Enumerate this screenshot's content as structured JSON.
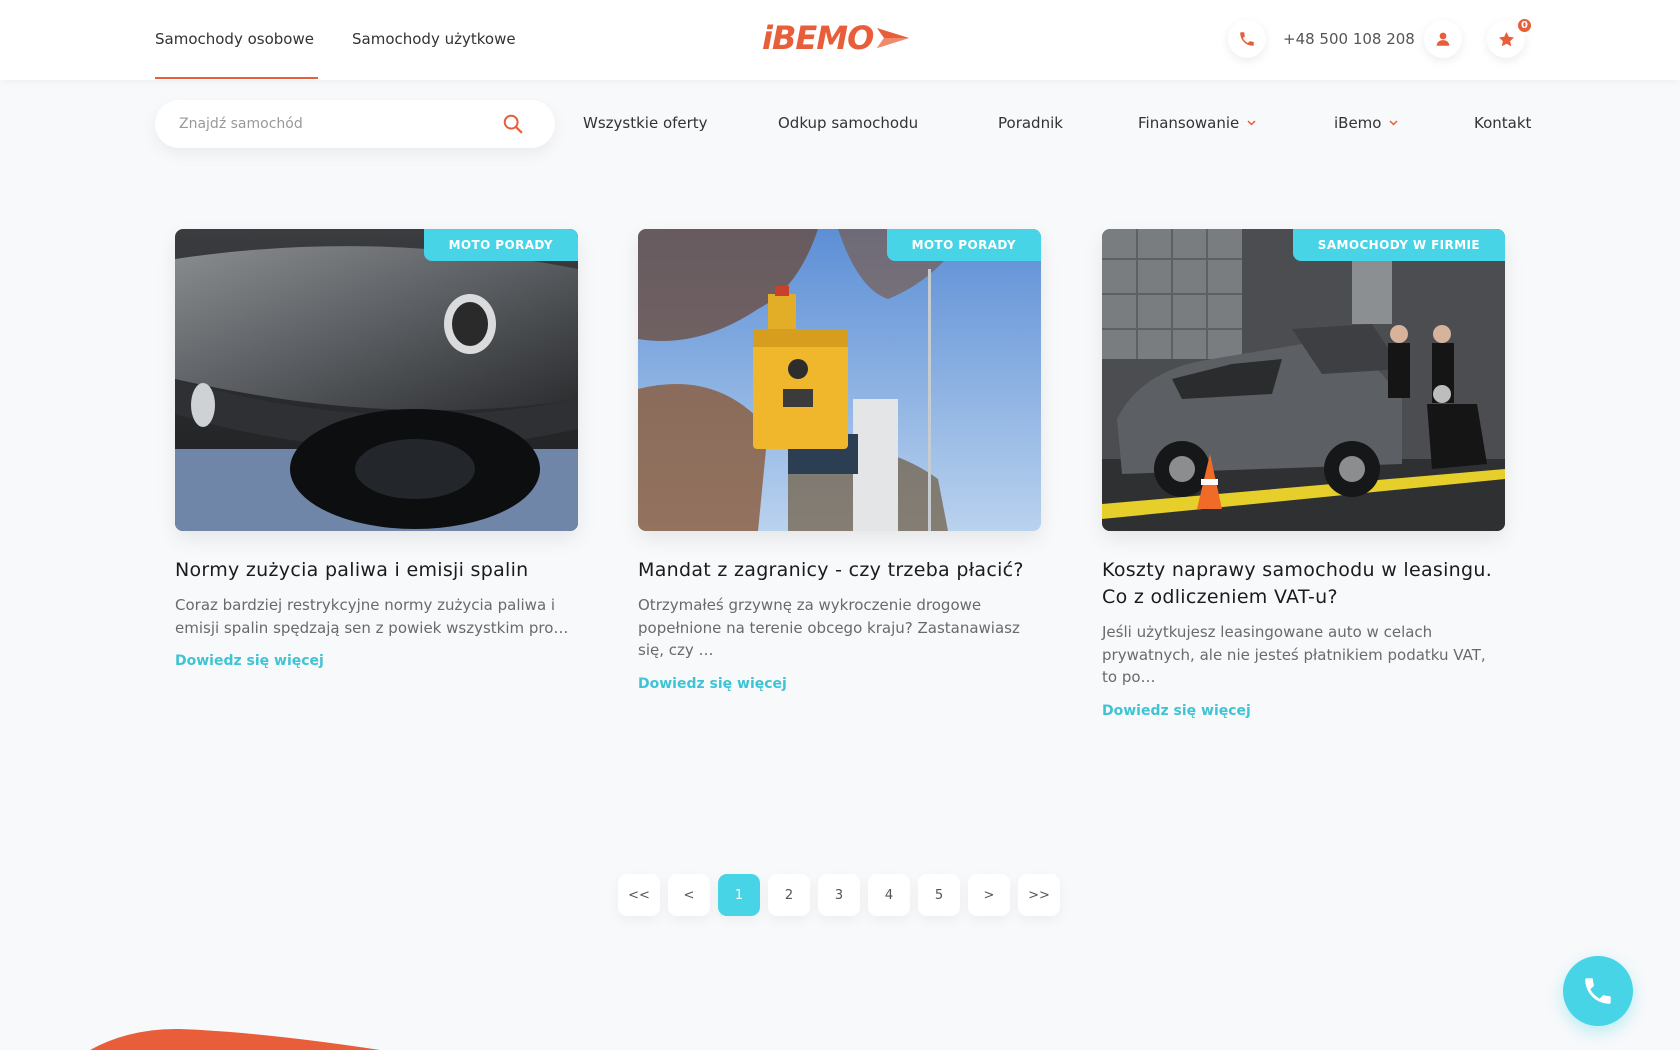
{
  "header": {
    "tabs": [
      {
        "label": "Samochody osobowe",
        "active": true
      },
      {
        "label": "Samochody użytkowe",
        "active": false
      }
    ],
    "logo_text": "iBEMO",
    "phone": "+48 500 108 208",
    "favorites_count": "0",
    "accent_color": "#e85d3a"
  },
  "search": {
    "placeholder": "Znajdź samochód",
    "value": ""
  },
  "nav": {
    "items": [
      {
        "label": "Wszystkie oferty"
      },
      {
        "label": "Odkup samochodu"
      },
      {
        "label": "Poradnik"
      },
      {
        "label": "Finansowanie",
        "dropdown": true
      },
      {
        "label": "iBemo",
        "dropdown": true
      },
      {
        "label": "Kontakt"
      }
    ]
  },
  "articles": [
    {
      "tag": "MOTO PORADY",
      "image": "car-exhaust-pipe-photo",
      "title": "Normy zużycia paliwa i emisji spalin",
      "excerpt": "Coraz bardziej restrykcyjne normy zużycia paliwa i emisji spalin spędzają sen z powiek wszystkim pro…",
      "more": "Dowiedz się więcej"
    },
    {
      "tag": "MOTO PORADY",
      "image": "speed-camera-photo",
      "title": "Mandat z zagranicy - czy trzeba płacić?",
      "excerpt": "Otrzymałeś grzywnę za wykroczenie drogowe popełnione na terenie obcego kraju? Zastanawiasz się, czy …",
      "more": "Dowiedz się więcej"
    },
    {
      "tag": "SAMOCHODY W FIRMIE",
      "image": "damaged-car-inspection-photo",
      "title": "Koszty naprawy samochodu w leasingu. Co z odliczeniem VAT-u?",
      "excerpt": "Jeśli użytkujesz leasingowane auto w celach prywatnych, ale nie jesteś płatnikiem podatku VAT, to po…",
      "more": "Dowiedz się więcej"
    }
  ],
  "pagination": {
    "first": "<<",
    "prev": "<",
    "pages": [
      "1",
      "2",
      "3",
      "4",
      "5"
    ],
    "current": "1",
    "next": ">",
    "last": ">>"
  },
  "colors": {
    "primary": "#e85d3a",
    "secondary": "#46d4e6",
    "background": "#f8f9fb"
  }
}
